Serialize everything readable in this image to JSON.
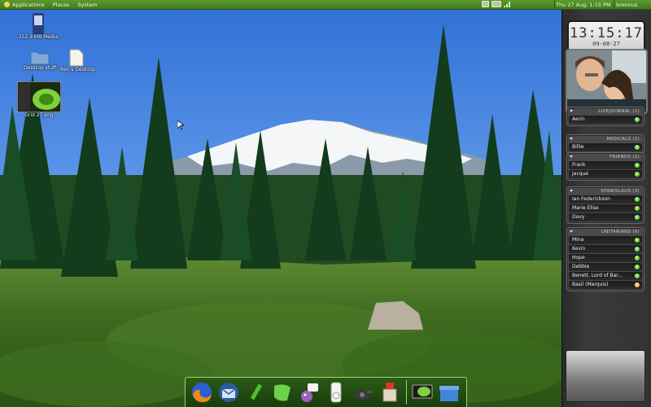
{
  "top_panel": {
    "menus": [
      "Applications",
      "Places",
      "System"
    ],
    "clock": "Thu 27 Aug, 1:15 PM",
    "user": "brennus",
    "tray_icons": [
      "network-icon",
      "volume-icon",
      "signal-icon"
    ]
  },
  "desktop_icons": [
    {
      "name": "media-drive-icon",
      "label": "252.9 MB Media"
    },
    {
      "name": "folder-icon",
      "label": "Desktop stuff"
    },
    {
      "name": "file-icon",
      "label": "Ben's Desktop"
    },
    {
      "name": "screenshot-thumbnail-icon",
      "label": "Grid 27.png"
    }
  ],
  "clock_widget": {
    "time": "13:15:17",
    "date": "09-08-27"
  },
  "buddy_list": {
    "groups": [
      {
        "name": "LIVEJOURNAL (1)",
        "buddies": [
          {
            "name": "Aerin",
            "status": "online"
          }
        ]
      },
      {
        "name": "RADICALS (1)",
        "buddies": [
          {
            "name": "Billie",
            "status": "online"
          }
        ]
      },
      {
        "name": "FRIENDS (2)",
        "buddies": [
          {
            "name": "Frank",
            "status": "online"
          },
          {
            "name": "Jacqué",
            "status": "online"
          }
        ]
      },
      {
        "name": "STANISLAUS (3)",
        "buddies": [
          {
            "name": "Ian Federickson",
            "status": "online"
          },
          {
            "name": "Marie Elise",
            "status": "online"
          },
          {
            "name": "Davy",
            "status": "online"
          }
        ]
      },
      {
        "name": "UNITARIANS (6)",
        "buddies": [
          {
            "name": "Mina",
            "status": "online"
          },
          {
            "name": "Kevin",
            "status": "online"
          },
          {
            "name": "Hope",
            "status": "online"
          },
          {
            "name": "Debbie",
            "status": "online"
          },
          {
            "name": "Benett, Lord of Bar...",
            "status": "online"
          },
          {
            "name": "Basil (Marquis)",
            "status": "away"
          }
        ]
      }
    ]
  },
  "dock": {
    "items": [
      "firefox-icon",
      "thunderbird-icon",
      "text-editor-icon",
      "notes-icon",
      "pidgin-icon",
      "ipod-icon",
      "gnome-camera-icon",
      "package-installer-icon",
      "terminal-monitor-icon",
      "storage-box-icon"
    ]
  },
  "colors": {
    "panel": "#4a8a24",
    "dock_border": "#9bd36d",
    "status_online": "#3fbf1c",
    "status_away": "#e0a214"
  }
}
